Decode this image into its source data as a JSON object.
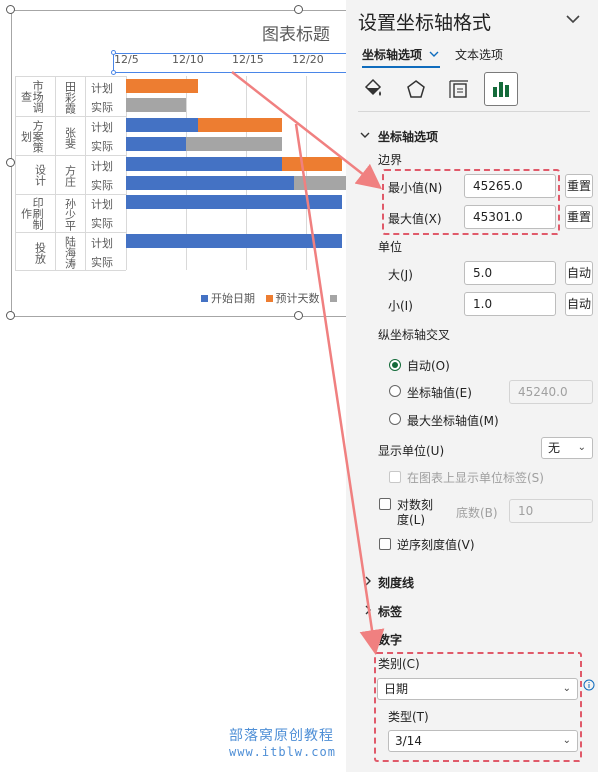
{
  "chart": {
    "title": "图表标题",
    "x_ticks": [
      "12/5",
      "12/10",
      "12/15",
      "12/20"
    ],
    "row_labels": [
      "计划",
      "实际",
      "计划",
      "实际",
      "计划",
      "实际",
      "计划",
      "实际",
      "计划",
      "实际"
    ],
    "categories": [
      {
        "stage": "市场调查",
        "person": "田彩霞"
      },
      {
        "stage": "方案策划",
        "person": "张斐"
      },
      {
        "stage": "设计",
        "person": "方庄"
      },
      {
        "stage": "印刷制作",
        "person": "孙少平"
      },
      {
        "stage": "投放",
        "person": "陆海涛"
      }
    ],
    "legend": [
      {
        "label": "开始日期",
        "color": "#4472c4"
      },
      {
        "label": "预计天数",
        "color": "#ed7d31"
      }
    ]
  },
  "chart_data": {
    "type": "bar",
    "orientation": "horizontal-stacked",
    "x_axis_min": "2023-12-03",
    "x_axis_major_unit_days": 5,
    "categories": [
      "市场调查 田彩霞 计划",
      "市场调查 田彩霞 实际",
      "方案策划 张斐 计划",
      "方案策划 张斐 实际",
      "设计 方庄 计划",
      "设计 方庄 实际",
      "印刷制作 孙少平 计划",
      "印刷制作 孙少平 实际",
      "投放 陆海涛 计划",
      "投放 陆海涛 实际"
    ],
    "series": [
      {
        "name": "开始日期",
        "color": "#4472c4",
        "values": [
          "2023-12-03",
          "2023-12-03",
          "2023-12-09",
          "2023-12-08",
          "2023-12-16",
          "2023-12-17",
          "2023-12-21",
          null,
          "2023-12-21",
          null
        ]
      },
      {
        "name": "预计天数",
        "color": "#ed7d31",
        "values": [
          6,
          0,
          7,
          0,
          5,
          0,
          0,
          0,
          0,
          0
        ]
      },
      {
        "name": "",
        "color": "#a5a5a5",
        "values": [
          0,
          5,
          0,
          8,
          0,
          5,
          0,
          0,
          0,
          0
        ]
      }
    ],
    "xtick_labels": [
      "12/5",
      "12/10",
      "12/15",
      "12/20"
    ]
  },
  "pane": {
    "title": "设置坐标轴格式",
    "tabs": [
      "坐标轴选项",
      "文本选项"
    ],
    "icons": [
      "fill-line-icon",
      "effects-icon",
      "size-properties-icon",
      "axis-options-icon"
    ],
    "axis_section": "坐标轴选项",
    "bounds_label": "边界",
    "min_label": "最小值(N)",
    "min_value": "45265.0",
    "max_label": "最大值(X)",
    "max_value": "45301.0",
    "reset_label": "重置",
    "units_label": "单位",
    "major_label": "大(J)",
    "major_value": "5.0",
    "minor_label": "小(I)",
    "minor_value": "1.0",
    "auto_label": "自动",
    "cross_label": "纵坐标轴交叉",
    "cross_auto": "自动(O)",
    "cross_value_label": "坐标轴值(E)",
    "cross_value": "45240.0",
    "cross_max": "最大坐标轴值(M)",
    "display_units_label": "显示单位(U)",
    "display_units_value": "无",
    "show_units_label": "在图表上显示单位标签(S)",
    "log_label_1": "对数刻",
    "log_label_2": "度(L)",
    "base_label": "底数(B)",
    "base_value": "10",
    "reverse_label": "逆序刻度值(V)",
    "tick_marks": "刻度线",
    "labels": "标签",
    "number": "数字",
    "category_label": "类别(C)",
    "category_value": "日期",
    "type_label": "类型(T)",
    "type_value": "3/14"
  },
  "watermark": {
    "line1": "部落窝原创教程",
    "line2": "www.itblw.com"
  }
}
